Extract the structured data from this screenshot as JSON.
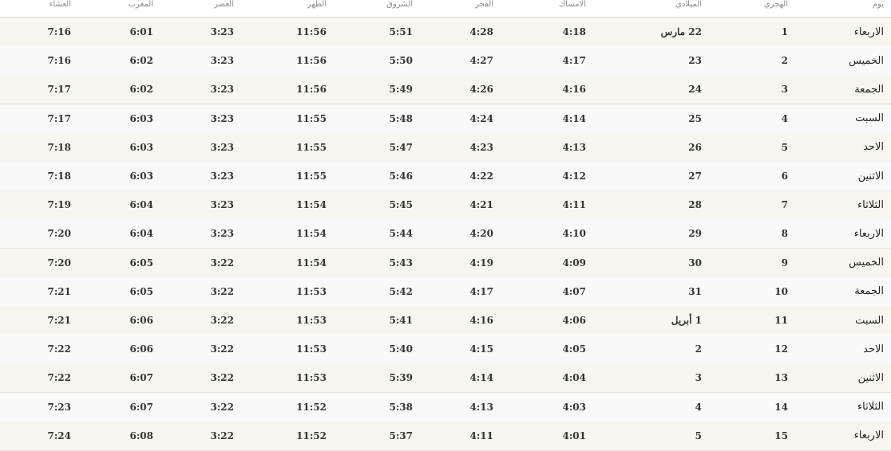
{
  "table": {
    "headers": {
      "day": "يوم",
      "hijri": "الهجري",
      "gregorian": "الميلادي",
      "imsak": "الامساك",
      "fajr": "الفجر",
      "shuruq": "الشروق",
      "dhuhr": "الظهر",
      "asr": "العصر",
      "maghrib": "المغرب",
      "isha": "العشاء"
    },
    "rows": [
      {
        "day": "الاربعاء",
        "hijri": "1",
        "gregorian": "22 مارس",
        "imsak": "4:18",
        "fajr": "4:28",
        "shuruq": "5:51",
        "dhuhr": "11:56",
        "asr": "3:23",
        "maghrib": "6:01",
        "isha": "7:16"
      },
      {
        "day": "الخميس",
        "hijri": "2",
        "gregorian": "23",
        "imsak": "4:17",
        "fajr": "4:27",
        "shuruq": "5:50",
        "dhuhr": "11:56",
        "asr": "3:23",
        "maghrib": "6:02",
        "isha": "7:16"
      },
      {
        "day": "الجمعة",
        "hijri": "3",
        "gregorian": "24",
        "imsak": "4:16",
        "fajr": "4:26",
        "shuruq": "5:49",
        "dhuhr": "11:56",
        "asr": "3:23",
        "maghrib": "6:02",
        "isha": "7:17"
      },
      {
        "day": "السبت",
        "hijri": "4",
        "gregorian": "25",
        "imsak": "4:14",
        "fajr": "4:24",
        "shuruq": "5:48",
        "dhuhr": "11:55",
        "asr": "3:23",
        "maghrib": "6:03",
        "isha": "7:17"
      },
      {
        "day": "الاحد",
        "hijri": "5",
        "gregorian": "26",
        "imsak": "4:13",
        "fajr": "4:23",
        "shuruq": "5:47",
        "dhuhr": "11:55",
        "asr": "3:23",
        "maghrib": "6:03",
        "isha": "7:18"
      },
      {
        "day": "الاثنين",
        "hijri": "6",
        "gregorian": "27",
        "imsak": "4:12",
        "fajr": "4:22",
        "shuruq": "5:46",
        "dhuhr": "11:55",
        "asr": "3:23",
        "maghrib": "6:03",
        "isha": "7:18"
      },
      {
        "day": "الثلاثاء",
        "hijri": "7",
        "gregorian": "28",
        "imsak": "4:11",
        "fajr": "4:21",
        "shuruq": "5:45",
        "dhuhr": "11:54",
        "asr": "3:23",
        "maghrib": "6:04",
        "isha": "7:19"
      },
      {
        "day": "الاربعاء",
        "hijri": "8",
        "gregorian": "29",
        "imsak": "4:10",
        "fajr": "4:20",
        "shuruq": "5:44",
        "dhuhr": "11:54",
        "asr": "3:23",
        "maghrib": "6:04",
        "isha": "7:20"
      },
      {
        "day": "الخميس",
        "hijri": "9",
        "gregorian": "30",
        "imsak": "4:09",
        "fajr": "4:19",
        "shuruq": "5:43",
        "dhuhr": "11:54",
        "asr": "3:22",
        "maghrib": "6:05",
        "isha": "7:20"
      },
      {
        "day": "الجمعة",
        "hijri": "10",
        "gregorian": "31",
        "imsak": "4:07",
        "fajr": "4:17",
        "shuruq": "5:42",
        "dhuhr": "11:53",
        "asr": "3:22",
        "maghrib": "6:05",
        "isha": "7:21"
      },
      {
        "day": "السبت",
        "hijri": "11",
        "gregorian": "1 أبريل",
        "imsak": "4:06",
        "fajr": "4:16",
        "shuruq": "5:41",
        "dhuhr": "11:53",
        "asr": "3:22",
        "maghrib": "6:06",
        "isha": "7:21"
      },
      {
        "day": "الاحد",
        "hijri": "12",
        "gregorian": "2",
        "imsak": "4:05",
        "fajr": "4:15",
        "shuruq": "5:40",
        "dhuhr": "11:53",
        "asr": "3:22",
        "maghrib": "6:06",
        "isha": "7:22"
      },
      {
        "day": "الاثنين",
        "hijri": "13",
        "gregorian": "3",
        "imsak": "4:04",
        "fajr": "4:14",
        "shuruq": "5:39",
        "dhuhr": "11:53",
        "asr": "3:22",
        "maghrib": "6:07",
        "isha": "7:22"
      },
      {
        "day": "الثلاثاء",
        "hijri": "14",
        "gregorian": "4",
        "imsak": "4:03",
        "fajr": "4:13",
        "shuruq": "5:38",
        "dhuhr": "11:52",
        "asr": "3:22",
        "maghrib": "6:07",
        "isha": "7:23"
      },
      {
        "day": "الاربعاء",
        "hijri": "15",
        "gregorian": "5",
        "imsak": "4:01",
        "fajr": "4:11",
        "shuruq": "5:37",
        "dhuhr": "11:52",
        "asr": "3:22",
        "maghrib": "6:08",
        "isha": "7:24"
      }
    ]
  },
  "colors": {
    "row_alt": "#f8f6f1",
    "row_plain": "#f9f9f9",
    "header_text": "#8a8a8a",
    "cell_text": "#333333"
  }
}
